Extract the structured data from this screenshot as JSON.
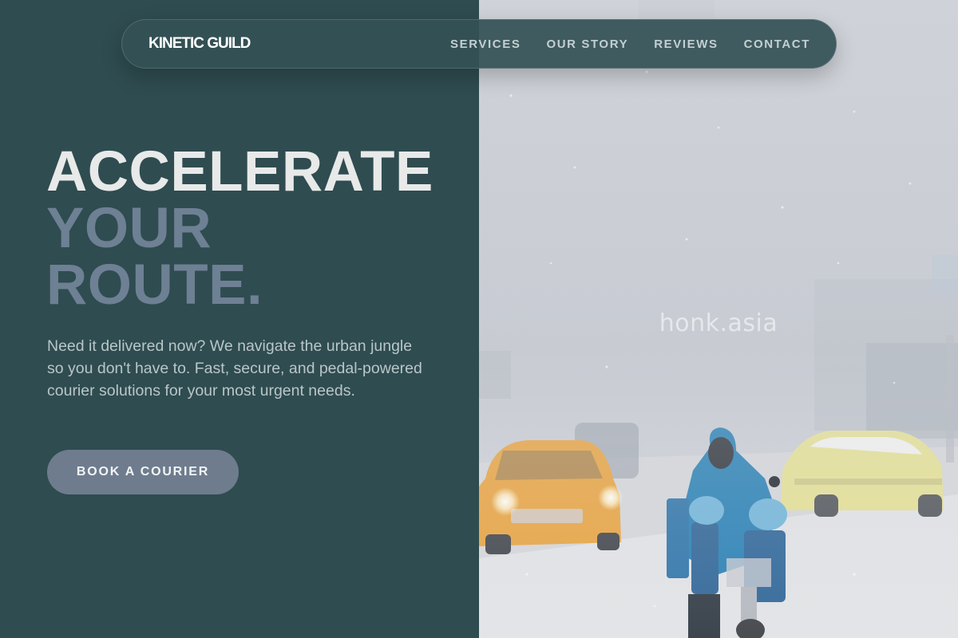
{
  "nav": {
    "brand": "KINETIC GUILD",
    "links": [
      "SERVICES",
      "OUR STORY",
      "REVIEWS",
      "CONTACT"
    ]
  },
  "hero": {
    "title_lines": [
      "ACCELERATE",
      "YOUR",
      "ROUTE."
    ],
    "description": "Need it delivered now? We navigate the urban jungle so you don't have to. Fast, secure, and pedal-powered courier solutions for your most urgent needs.",
    "cta_label": "BOOK A COURIER"
  },
  "photo": {
    "watermark": "honk.asia",
    "subject": "courier on electric bike in snowstorm with taxis"
  },
  "colors": {
    "panel": "#2f4c50",
    "title_primary": "#e8e9e9",
    "title_secondary": "#6e8093",
    "button": "#6e7c8e"
  }
}
